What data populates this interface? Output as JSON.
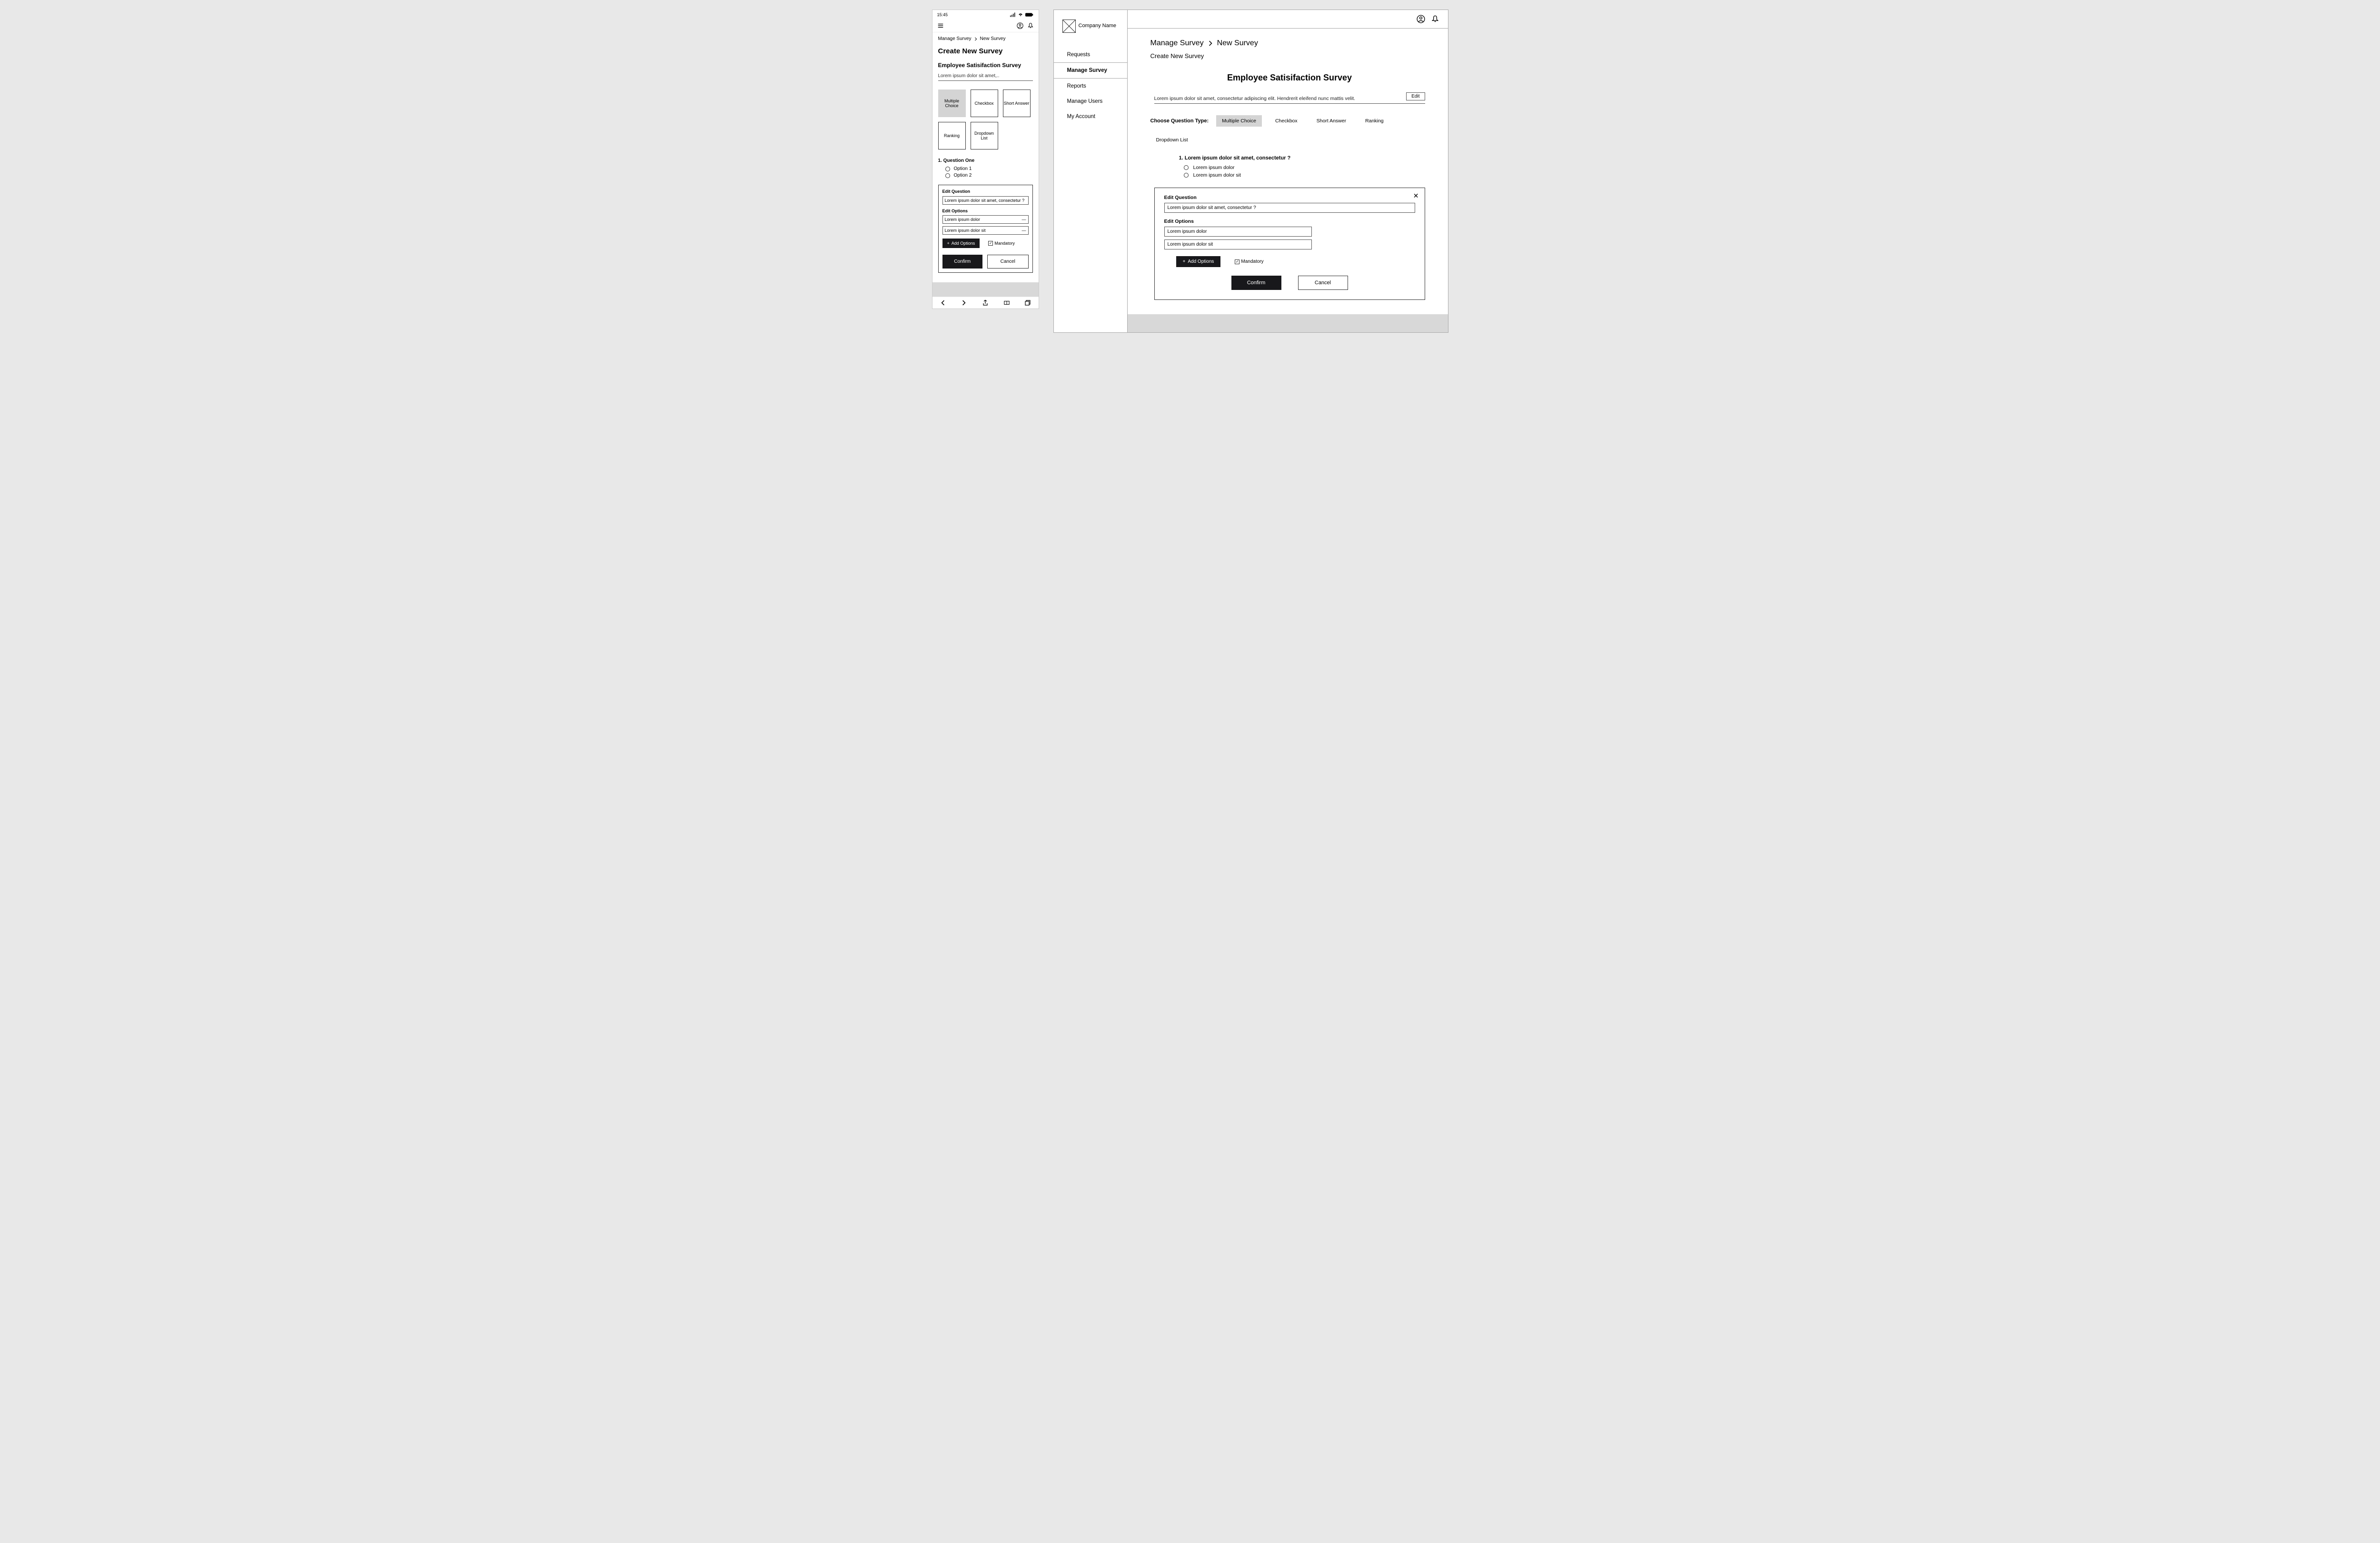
{
  "mobile": {
    "status_time": "15:45",
    "breadcrumb": {
      "a": "Manage Survey",
      "b": "New Survey"
    },
    "page_title": "Create New Survey",
    "survey_title": "Employee Satisifaction Survey",
    "survey_desc": "Lorem ipsum dolor sit amet,..",
    "qtypes": [
      "Multiple Choice",
      "Checkbox",
      "Short Answer",
      "Ranking",
      "Dropdown List"
    ],
    "question_label": "1.  Question One",
    "options": [
      "Option 1",
      "Option 2"
    ],
    "edit_question_label": "Edit Question",
    "edit_question_value": "Lorem ipsum dolor sit amet, consectetur ?",
    "edit_options_label": "Edit Options",
    "edit_options": [
      "Lorem ipsum dolor",
      "Lorem ipsum dolor sit"
    ],
    "add_options": "Add Options",
    "mandatory": "Mandatory",
    "confirm": "Confirm",
    "cancel": "Cancel"
  },
  "desktop": {
    "company": "Company Name",
    "nav": [
      "Requests",
      "Manage Survey",
      "Reports",
      "Manage Users",
      "My Account"
    ],
    "breadcrumb": {
      "a": "Manage Survey",
      "b": "New Survey"
    },
    "subtitle": "Create New Survey",
    "survey_title": "Employee Satisifaction Survey",
    "survey_desc": "Lorem ipsum dolor sit amet, consectetur adipiscing elit. Hendrerit eleifend nunc mattis velit.",
    "edit": "Edit",
    "qtype_label": "Choose Question Type:",
    "qtypes": [
      "Multiple Choice",
      "Checkbox",
      "Short Answer",
      "Ranking",
      "Dropdown List"
    ],
    "question_text": "1.  Lorem ipsum dolor sit amet, consectetur ?",
    "options": [
      "Lorem ipsum dolor",
      "Lorem ipsum dolor sit"
    ],
    "edit_question_label": "Edit Question",
    "edit_question_value": "Lorem ipsum dolor sit amet, consectetur ?",
    "edit_options_label": "Edit Options",
    "edit_options": [
      "Lorem ipsum dolor",
      "Lorem ipsum dolor sit"
    ],
    "add_options": "Add Options",
    "mandatory": "Mandatory",
    "confirm": "Confirm",
    "cancel": "Cancel"
  }
}
